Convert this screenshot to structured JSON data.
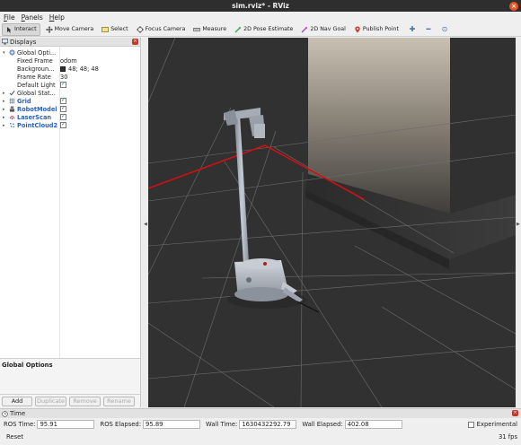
{
  "window": {
    "title": "sim.rviz* - RViz",
    "close_glyph": "×"
  },
  "menu": [
    {
      "label": "File"
    },
    {
      "label": "Panels"
    },
    {
      "label": "Help"
    }
  ],
  "toolbar": [
    {
      "label": "Interact",
      "active": true,
      "icon": "interact-icon"
    },
    {
      "label": "Move Camera",
      "icon": "move-camera-icon"
    },
    {
      "label": "Select",
      "icon": "select-icon"
    },
    {
      "label": "Focus Camera",
      "icon": "focus-camera-icon"
    },
    {
      "label": "Measure",
      "icon": "measure-icon"
    },
    {
      "label": "2D Pose Estimate",
      "icon": "pose-estimate-icon"
    },
    {
      "label": "2D Nav Goal",
      "icon": "nav-goal-icon"
    },
    {
      "label": "Publish Point",
      "icon": "publish-point-icon"
    }
  ],
  "toolbar_icons": {
    "add": "✚",
    "remove": "━",
    "camera": "⊙"
  },
  "displays": {
    "title": "Displays",
    "close_glyph": "×",
    "global_options": {
      "label": "Global Opti...",
      "fixed_frame_label": "Fixed Frame",
      "fixed_frame_value": "odom",
      "background_label": "Backgroun...",
      "background_value": "48; 48; 48",
      "background_color": "#303030",
      "frame_rate_label": "Frame Rate",
      "frame_rate_value": "30",
      "default_light_label": "Default Light"
    },
    "global_status_label": "Global Stat...",
    "items": [
      {
        "label": "Grid",
        "icon": "grid-icon"
      },
      {
        "label": "RobotModel",
        "icon": "robot-model-icon"
      },
      {
        "label": "LaserScan",
        "icon": "laser-scan-icon"
      },
      {
        "label": "PointCloud2",
        "icon": "point-cloud-icon"
      }
    ],
    "description_title": "Global Options",
    "buttons": {
      "add": "Add",
      "duplicate": "Duplicate",
      "remove": "Remove",
      "rename": "Rename"
    }
  },
  "splitter_glyphs": {
    "left": "◀",
    "right": "▶"
  },
  "time": {
    "title": "Time",
    "close_glyph": "×",
    "ros_time_label": "ROS Time:",
    "ros_time_value": "95.91",
    "ros_elapsed_label": "ROS Elapsed:",
    "ros_elapsed_value": "95.89",
    "wall_time_label": "Wall Time:",
    "wall_time_value": "1630432292.79",
    "wall_elapsed_label": "Wall Elapsed:",
    "wall_elapsed_value": "402.08",
    "experimental_label": "Experimental"
  },
  "status": {
    "reset_label": "Reset",
    "fps": "31 fps"
  },
  "colors": {
    "accent": "#2a62b8",
    "axis_x": "#d01010",
    "viewport_bg": "#303030",
    "close": "#e95420"
  }
}
